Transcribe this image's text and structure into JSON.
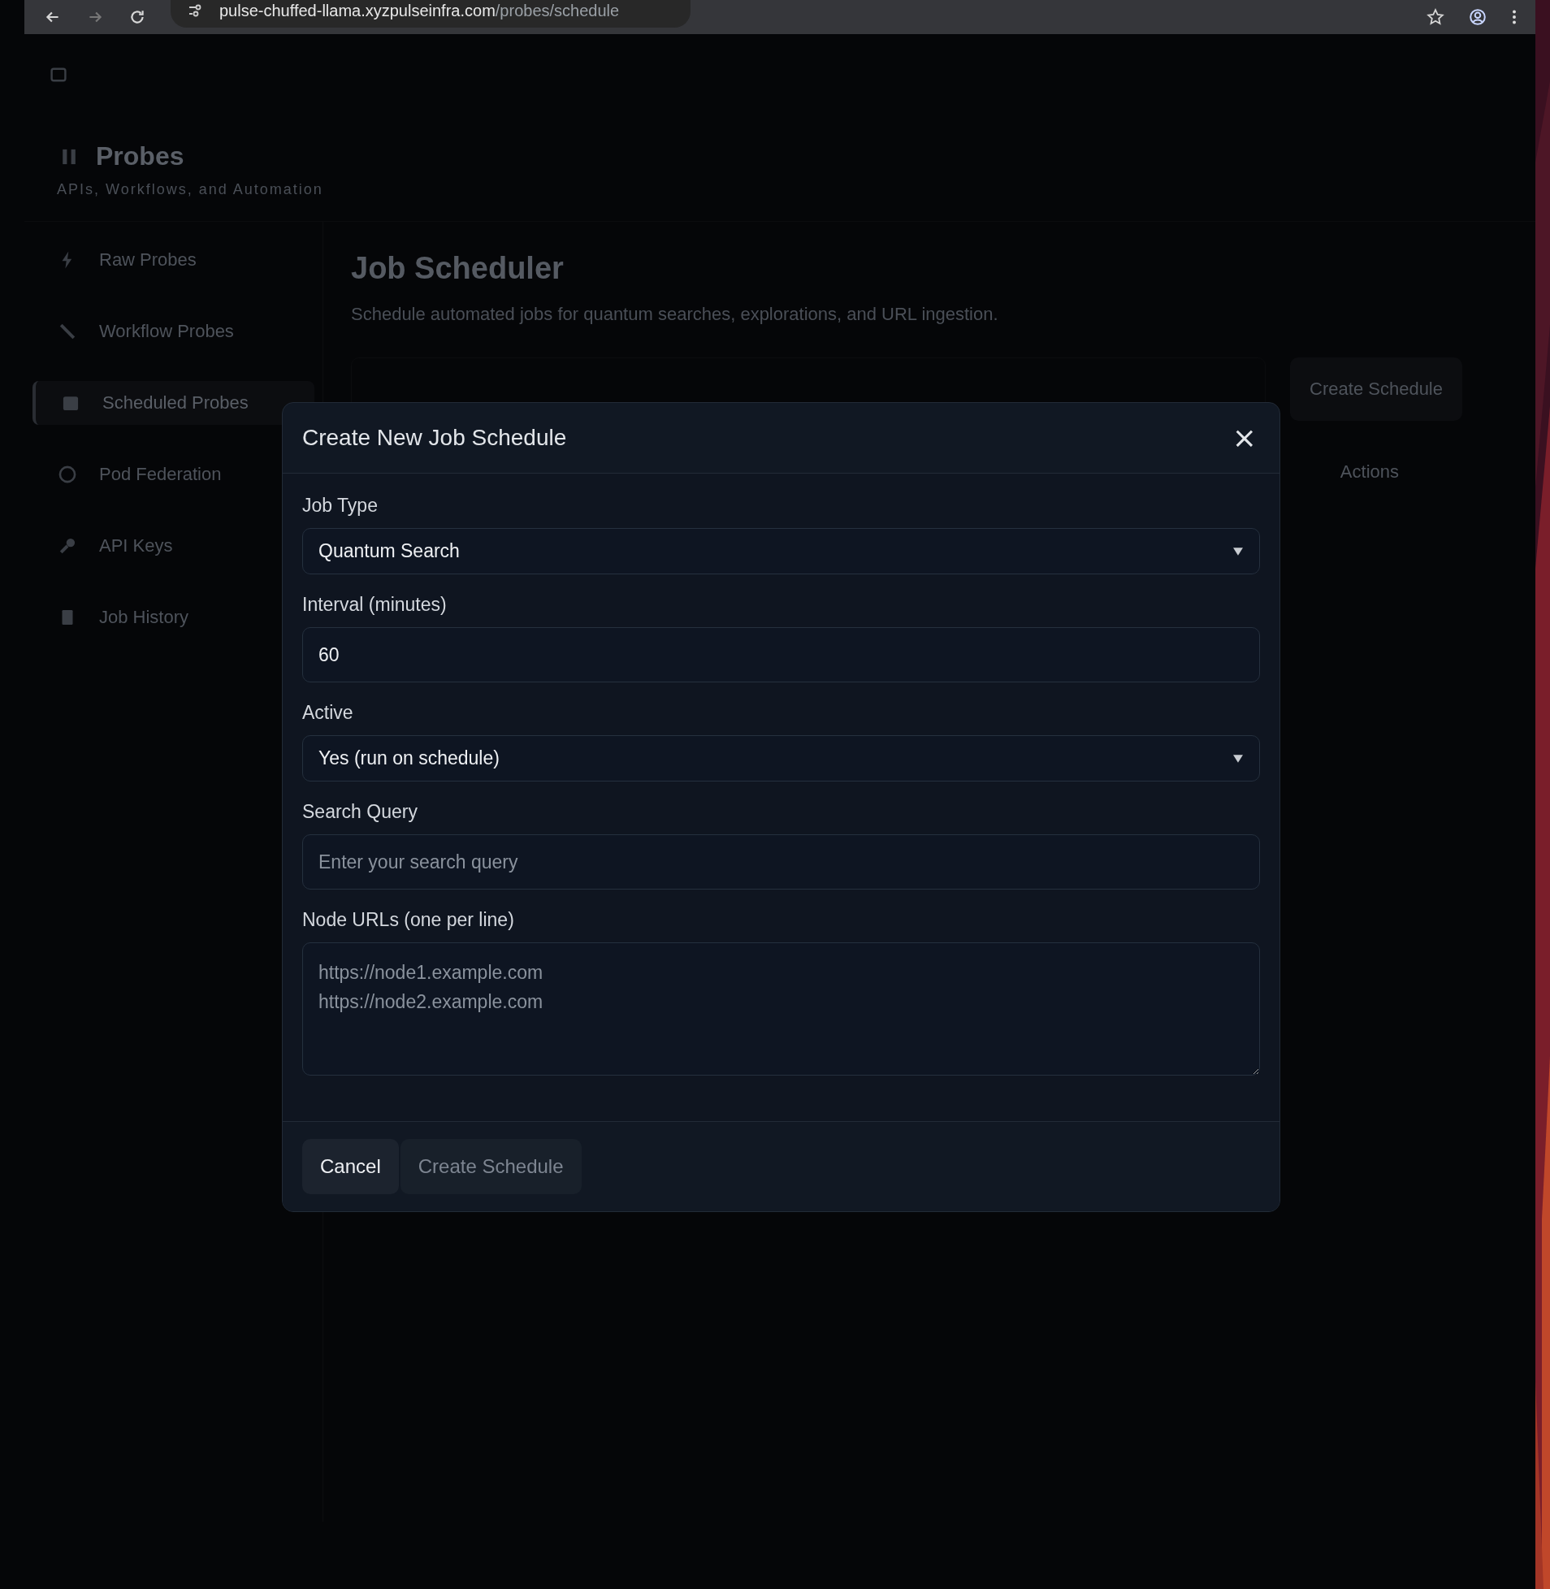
{
  "browser": {
    "url_host": "pulse-chuffed-llama.xyzpulseinfra.com",
    "url_path": "/probes/schedule"
  },
  "sidebar": {
    "title": "Probes",
    "subtitle": "APIs, Workflows, and Automation",
    "items": [
      {
        "label": "Raw Probes",
        "selected": false
      },
      {
        "label": "Workflow Probes",
        "selected": false
      },
      {
        "label": "Scheduled Probes",
        "selected": true
      },
      {
        "label": "Pod Federation",
        "selected": false
      },
      {
        "label": "API Keys",
        "selected": false
      },
      {
        "label": "Job History",
        "selected": false
      }
    ]
  },
  "main": {
    "title": "Job Scheduler",
    "subtitle": "Schedule automated jobs for quantum searches, explorations, and URL ingestion.",
    "create_button": "Create Schedule",
    "column_header": "Actions"
  },
  "modal": {
    "title": "Create New Job Schedule",
    "close": "×",
    "fields": [
      {
        "kind": "select",
        "label": "Job Type",
        "value": "Quantum Search"
      },
      {
        "kind": "input",
        "label": "Interval (minutes)",
        "value": "60"
      },
      {
        "kind": "select",
        "label": "Active",
        "value": "Yes (run on schedule)"
      },
      {
        "kind": "input",
        "label": "Search Query",
        "placeholder": "Enter your search query"
      },
      {
        "kind": "textarea",
        "label": "Node URLs (one per line)",
        "placeholder": "https://node1.example.com\nhttps://node2.example.com"
      }
    ],
    "buttons": [
      {
        "label": "Cancel",
        "disabled": false
      },
      {
        "label": "Create Schedule",
        "disabled": true
      }
    ]
  }
}
